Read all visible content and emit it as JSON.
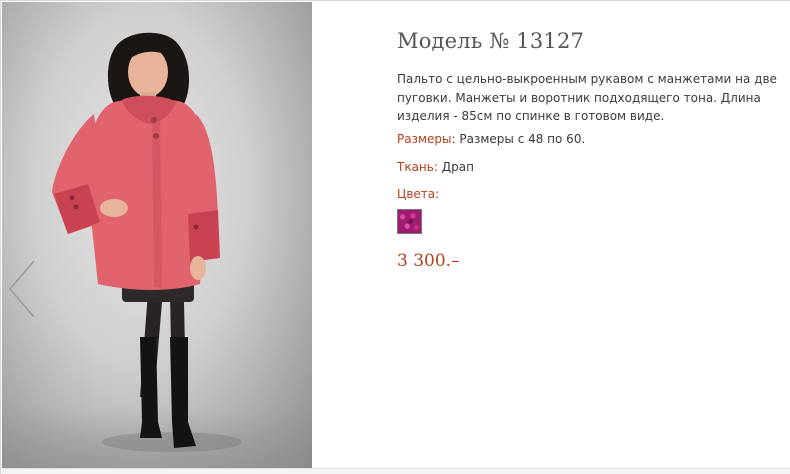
{
  "product": {
    "title": "Модель № 13127",
    "description": "Пальто с цельно-выкроенным рукавом с манжетами на две пуговки. Манжеты и воротник подходящего тона. Длина изделия - 85см по спинке в готовом виде.",
    "sizes_label": "Размеры:",
    "sizes_value": "Размеры с 48 по 60.",
    "fabric_label": "Ткань:",
    "fabric_value": "Драп",
    "colors_label": "Цвета:",
    "color_swatches": [
      {
        "name": "magenta-boucle",
        "color": "#a01c73"
      }
    ],
    "price": "3 300.–"
  },
  "photo": {
    "alt": "model in pink coat",
    "coat_color": "#e0636e",
    "cuff_color": "#c84252"
  },
  "colors": {
    "accent": "#b5401e",
    "text": "#3a3a3a",
    "title": "#555555"
  },
  "icons": {
    "prev": "chevron-left-icon"
  }
}
